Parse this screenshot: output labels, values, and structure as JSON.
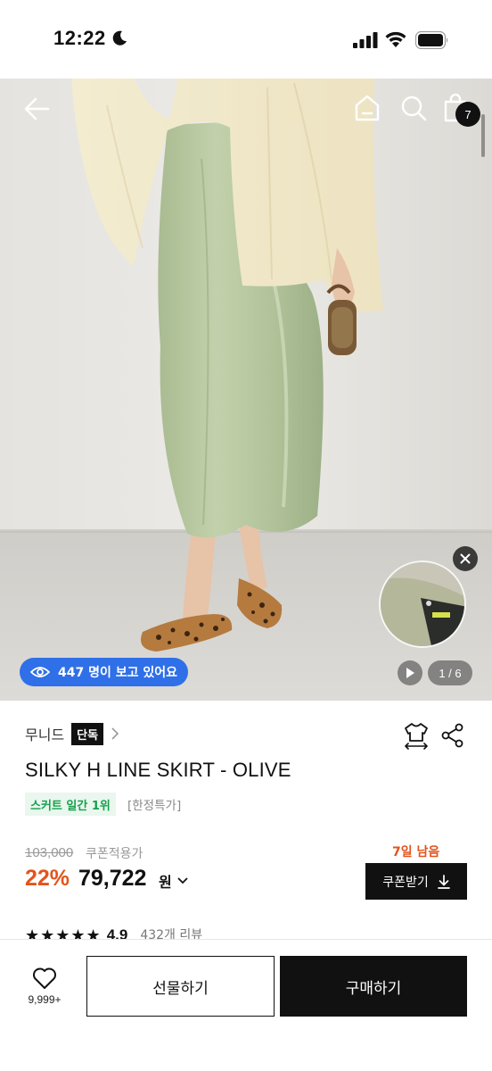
{
  "status_bar": {
    "time": "12:22"
  },
  "header": {
    "cart_count": "7"
  },
  "hero": {
    "viewers_text": "447 명이 보고 있어요",
    "page_counter": "1 / 6"
  },
  "product": {
    "brand": "무니드",
    "exclusive_label": "단독",
    "title": "SILKY H LINE SKIRT - OLIVE",
    "rank_badge": "스커트 일간 1위",
    "limited_tag": "[한정특가]",
    "original_price": "103,000",
    "coupon_applied_label": "쿠폰적용가",
    "days_left": "7일 남음",
    "discount": "22%",
    "sale_price": "79,722",
    "currency": "원",
    "coupon_button": "쿠폰받기",
    "rating_stars": "★★★★★",
    "rating_score": "4.9",
    "review_count": "432개 리뷰"
  },
  "bottom_bar": {
    "like_count": "9,999+",
    "gift_label": "선물하기",
    "buy_label": "구매하기"
  },
  "colors": {
    "accent_blue": "#2f6fe8",
    "discount_orange": "#e2541c",
    "rank_green": "#15a04b",
    "skirt_olive": "#b6c79e"
  }
}
